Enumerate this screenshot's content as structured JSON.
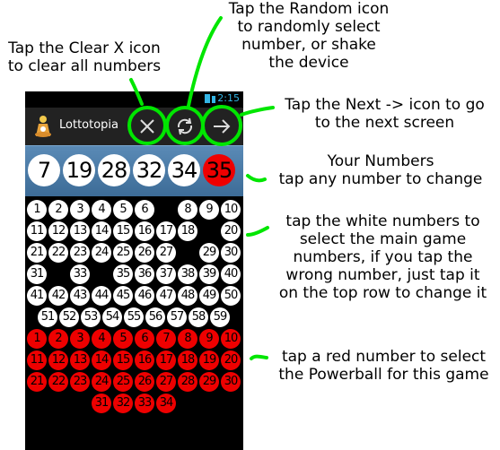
{
  "annotations": {
    "clear": [
      "Tap the Clear X icon",
      "to clear all numbers"
    ],
    "random": [
      "Tap the Random icon",
      "to randomly select",
      "number, or shake",
      "the device"
    ],
    "next": [
      "Tap the Next -> icon to go",
      "to the next screen"
    ],
    "your_numbers": [
      "Your Numbers",
      "tap any number to change"
    ],
    "white": [
      "tap the white numbers to",
      "select the main game",
      "numbers, if you tap the",
      "wrong number, just tap it",
      "on the top row to change it"
    ],
    "red": [
      "tap a red number to select",
      "the Powerball for this game"
    ]
  },
  "status_bar": {
    "time": "2:15"
  },
  "action_bar": {
    "title": "Lottotopia",
    "clear_icon": "close-icon",
    "random_icon": "refresh-icon",
    "next_icon": "arrow-right-icon"
  },
  "picked": {
    "main": [
      "7",
      "19",
      "28",
      "32",
      "34"
    ],
    "powerball": "35"
  },
  "white_numbers": [
    [
      "1",
      "2",
      "3",
      "4",
      "5",
      "6",
      null,
      "8",
      "9",
      "10"
    ],
    [
      "11",
      "12",
      "13",
      "14",
      "15",
      "16",
      "17",
      "18",
      null,
      "20"
    ],
    [
      "21",
      "22",
      "23",
      "24",
      "25",
      "26",
      "27",
      null,
      "29",
      "30"
    ],
    [
      "31",
      null,
      "33",
      null,
      "35",
      "36",
      "37",
      "38",
      "39",
      "40"
    ],
    [
      "41",
      "42",
      "43",
      "44",
      "45",
      "46",
      "47",
      "48",
      "49",
      "50"
    ],
    [
      null,
      "51",
      "52",
      "53",
      "54",
      "55",
      "56",
      "57",
      "58",
      "59",
      null
    ]
  ],
  "red_numbers": [
    [
      "1",
      "2",
      "3",
      "4",
      "5",
      "6",
      "7",
      "8",
      "9",
      "10"
    ],
    [
      "11",
      "12",
      "13",
      "14",
      "15",
      "16",
      "17",
      "18",
      "19",
      "20"
    ],
    [
      "21",
      "22",
      "23",
      "24",
      "25",
      "26",
      "27",
      "28",
      "29",
      "30"
    ],
    [
      null,
      null,
      null,
      "31",
      "32",
      "33",
      "34",
      null,
      null,
      null
    ]
  ],
  "colors": {
    "highlight": "#00e600",
    "powerball": "#ee0000",
    "status_time": "#33b5e5"
  }
}
